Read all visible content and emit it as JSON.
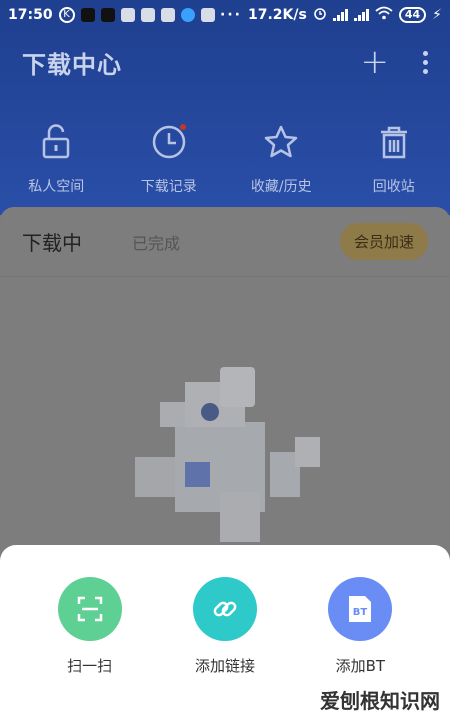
{
  "status_bar": {
    "time": "17:50",
    "network_speed": "17.2K/s",
    "battery": "44",
    "dots": "···"
  },
  "header": {
    "title": "下载中心"
  },
  "quick_actions": [
    {
      "label": "私人空间",
      "icon": "unlock-icon"
    },
    {
      "label": "下载记录",
      "icon": "clock-icon"
    },
    {
      "label": "收藏/历史",
      "icon": "star-icon"
    },
    {
      "label": "回收站",
      "icon": "trash-icon"
    }
  ],
  "tabs": {
    "active": "下载中",
    "other": "已完成",
    "vip_button": "会员加速"
  },
  "sheet": {
    "actions": [
      {
        "label": "扫一扫",
        "color": "#5fd093",
        "icon": "scan-icon"
      },
      {
        "label": "添加链接",
        "color": "#2ec9c9",
        "icon": "link-icon"
      },
      {
        "label": "添加BT",
        "color": "#6a8cf5",
        "icon": "bt-icon",
        "icon_text": "BT"
      }
    ]
  },
  "watermark": "爱刨根知识网",
  "colors": {
    "header_bg": "#1f3f8f",
    "vip_bg": "#8f7a4a"
  }
}
